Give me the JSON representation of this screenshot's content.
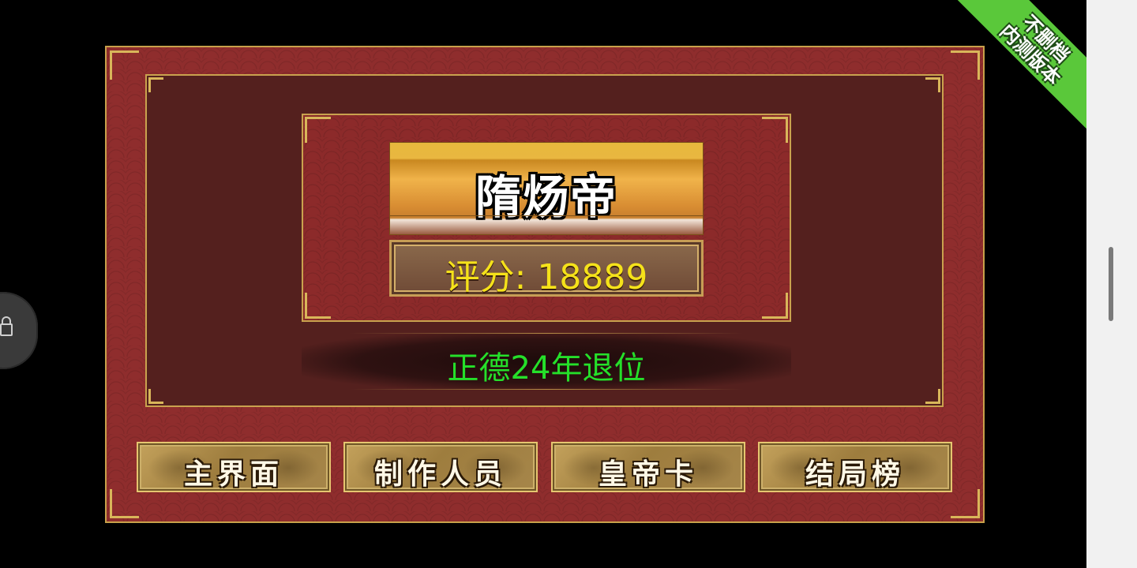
{
  "ribbon": {
    "line1": "不删档",
    "line2": "内测版本",
    "color": "#5ac83a"
  },
  "emperor": {
    "name": "隋炀帝",
    "score_text": "评分: 18889"
  },
  "reign": {
    "text": "正德24年退位",
    "color": "#25e02a"
  },
  "menu": {
    "buttons": [
      {
        "label": "主界面"
      },
      {
        "label": "制作人员"
      },
      {
        "label": "皇帝卡"
      },
      {
        "label": "结局榜"
      }
    ]
  },
  "colors": {
    "board": "#8f2d2d",
    "inner_panel": "#54201e",
    "gold_border": "#c9a24e",
    "score_text": "#f5e21a"
  }
}
